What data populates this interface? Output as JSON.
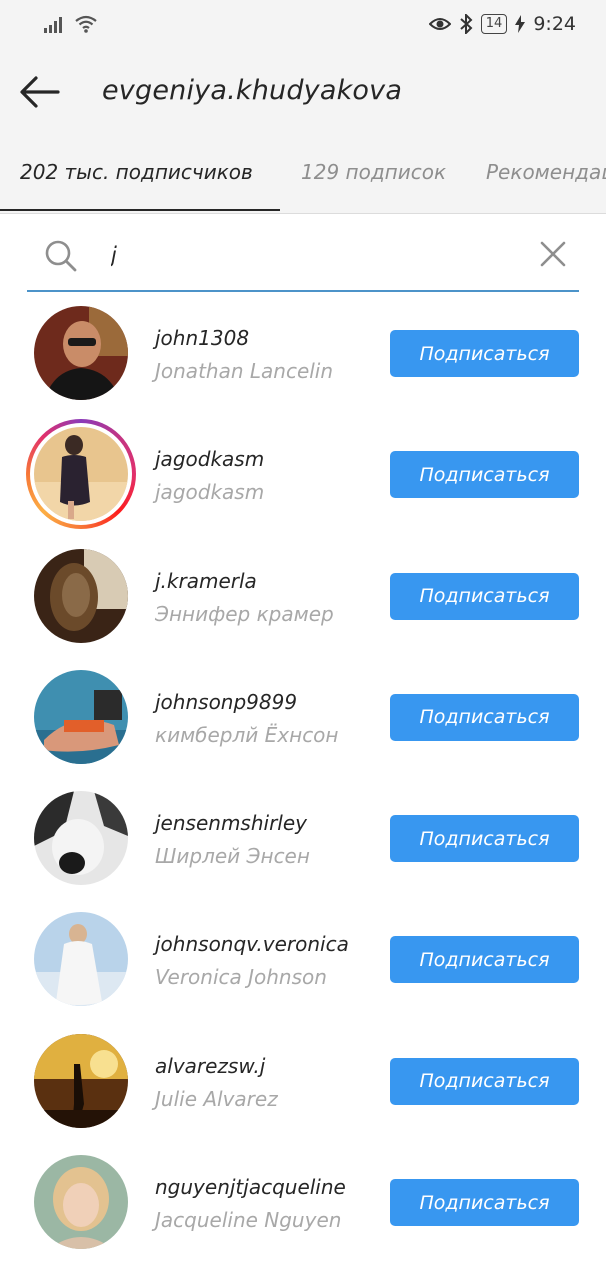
{
  "status_bar": {
    "time": "9:24",
    "battery": "14"
  },
  "header": {
    "title": "evgeniya.khudyakova"
  },
  "tabs": [
    {
      "label": "202 тыс. подписчиков",
      "active": true
    },
    {
      "label": "129 подписок",
      "active": false
    },
    {
      "label": "Рекомендации",
      "active": false
    }
  ],
  "search": {
    "value": "j"
  },
  "follow_label": "Подписаться",
  "accent_color": "#3897f0",
  "users": [
    {
      "username": "john1308",
      "full_name": "Jonathan Lancelin"
    },
    {
      "username": "jagodkasm",
      "full_name": "jagodkasm",
      "has_story": true
    },
    {
      "username": "j.kramerla",
      "full_name": "Эннифер крамер"
    },
    {
      "username": "johnsonp9899",
      "full_name": "кимберлй Ёхнсон"
    },
    {
      "username": "jensenmshirley",
      "full_name": "Ширлей Энсен"
    },
    {
      "username": "johnsonqv.veronica",
      "full_name": "Veronica Johnson"
    },
    {
      "username": "alvarezsw.j",
      "full_name": "Julie Alvarez"
    },
    {
      "username": "nguyenjtjacqueline",
      "full_name": "Jacqueline Nguyen"
    }
  ]
}
